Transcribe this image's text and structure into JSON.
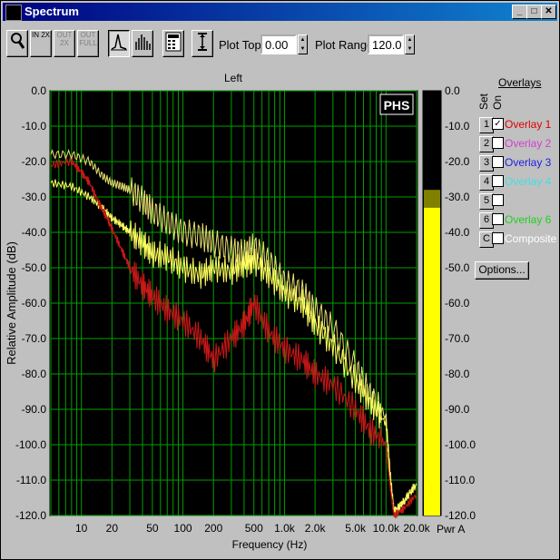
{
  "window": {
    "title": "Spectrum"
  },
  "title_buttons": {
    "minimize": "_",
    "maximize": "□",
    "close": "✕"
  },
  "toolbar": {
    "buttons": [
      {
        "name": "zoom",
        "label": "🔍",
        "enabled": true
      },
      {
        "name": "in-2x",
        "label": "IN 2X",
        "enabled": true
      },
      {
        "name": "out-2x",
        "label": "OUT 2X",
        "enabled": false
      },
      {
        "name": "out-full",
        "label": "OUT FULL",
        "enabled": false
      },
      {
        "name": "line-mode",
        "label": "line",
        "enabled": true,
        "pressed": true
      },
      {
        "name": "bar-mode",
        "label": "bars",
        "enabled": true
      },
      {
        "name": "calculator",
        "label": "calc",
        "enabled": true
      },
      {
        "name": "range-marker",
        "label": "range",
        "enabled": true
      }
    ],
    "plot_top_label": "Plot Top:",
    "plot_top_value": "0.00",
    "plot_range_label": "Plot Range:",
    "plot_range_value": "120.0"
  },
  "chart_data": {
    "type": "line",
    "title": "Left",
    "xlabel": "Frequency (Hz)",
    "ylabel": "Relative Amplitude (dB)",
    "x_scale": "log",
    "xlim": [
      5,
      20000
    ],
    "ylim": [
      -120,
      0
    ],
    "x_ticks": [
      {
        "v": 10,
        "label": "10"
      },
      {
        "v": 20,
        "label": "20"
      },
      {
        "v": 50,
        "label": "50"
      },
      {
        "v": 100,
        "label": "100"
      },
      {
        "v": 200,
        "label": "200"
      },
      {
        "v": 500,
        "label": "500"
      },
      {
        "v": 1000,
        "label": "1.0k"
      },
      {
        "v": 2000,
        "label": "2.0k"
      },
      {
        "v": 5000,
        "label": "5.0k"
      },
      {
        "v": 10000,
        "label": "10.0k"
      },
      {
        "v": 20000,
        "label": "20.0k"
      }
    ],
    "y_ticks": [
      "0.0",
      "-10.0",
      "-20.0",
      "-30.0",
      "-40.0",
      "-50.0",
      "-60.0",
      "-70.0",
      "-80.0",
      "-90.0",
      "-100.0",
      "-110.0",
      "-120.0"
    ],
    "grid": true,
    "watermark": "PHS",
    "series": [
      {
        "color": "#e8e070",
        "x": [
          5,
          8,
          12,
          16,
          20,
          25,
          30,
          40,
          50,
          70,
          100,
          150,
          200,
          300,
          400,
          500,
          700,
          1000,
          1500,
          2000,
          3000,
          5000,
          7000,
          10000,
          11000,
          12000,
          15000,
          20000
        ],
        "y": [
          -18,
          -18,
          -20,
          -24,
          -26,
          -27,
          -28,
          -31,
          -34,
          -37,
          -40,
          -41,
          -43,
          -45,
          -46,
          -44,
          -48,
          -54,
          -57,
          -62,
          -67,
          -78,
          -86,
          -92,
          -108,
          -119,
          -116,
          -111
        ]
      },
      {
        "color": "#ffff60",
        "x": [
          5,
          8,
          12,
          16,
          20,
          25,
          30,
          40,
          50,
          70,
          100,
          150,
          200,
          300,
          400,
          500,
          700,
          1000,
          1500,
          2000,
          3000,
          5000,
          7000,
          10000,
          11000,
          12000,
          15000,
          20000
        ],
        "y": [
          -26,
          -27,
          -30,
          -33,
          -36,
          -38,
          -40,
          -43,
          -46,
          -47,
          -50,
          -52,
          -50,
          -51,
          -49,
          -48,
          -52,
          -57,
          -60,
          -66,
          -72,
          -82,
          -88,
          -94,
          -110,
          -119,
          -116,
          -111
        ]
      },
      {
        "color": "#c81818",
        "x": [
          5,
          8,
          10,
          12,
          15,
          18,
          20,
          25,
          30,
          40,
          50,
          70,
          100,
          150,
          200,
          300,
          400,
          500,
          700,
          1000,
          1500,
          2000,
          3000,
          5000,
          7000,
          10000,
          11000,
          12000,
          15000,
          20000
        ],
        "y": [
          -21,
          -20,
          -23,
          -26,
          -32,
          -36,
          -39,
          -45,
          -50,
          -55,
          -58,
          -62,
          -65,
          -70,
          -76,
          -70,
          -66,
          -60,
          -68,
          -73,
          -76,
          -80,
          -83,
          -90,
          -96,
          -100,
          -112,
          -120,
          -118,
          -114
        ]
      }
    ]
  },
  "meter": {
    "unit": "Pwr A",
    "level_db": -33.0,
    "peak_db": -28.0,
    "ticks": [
      "0.0",
      "-10.0",
      "-20.0",
      "-30.0",
      "-40.0",
      "-50.0",
      "-60.0",
      "-70.0",
      "-80.0",
      "-90.0",
      "-100.0",
      "-110.0",
      "-120.0"
    ]
  },
  "overlays": {
    "title": "Overlays",
    "header_set": "Set",
    "header_on": "On",
    "items": [
      {
        "set": "1",
        "label": "Overlay 1",
        "color": "#e00000",
        "checked": true
      },
      {
        "set": "2",
        "label": "Overlay 2",
        "color": "#d040d0",
        "checked": false
      },
      {
        "set": "3",
        "label": "Overlay 3",
        "color": "#2020e0",
        "checked": false
      },
      {
        "set": "4",
        "label": "Overlay 4",
        "color": "#40e0e0",
        "checked": false
      },
      {
        "set": "5",
        "label": "",
        "color": "#000000",
        "checked": false
      },
      {
        "set": "6",
        "label": "Overlay 6",
        "color": "#20d020",
        "checked": false
      },
      {
        "set": "C",
        "label": "Composite",
        "color": "#ffffff",
        "checked": false
      }
    ],
    "options_label": "Options..."
  }
}
